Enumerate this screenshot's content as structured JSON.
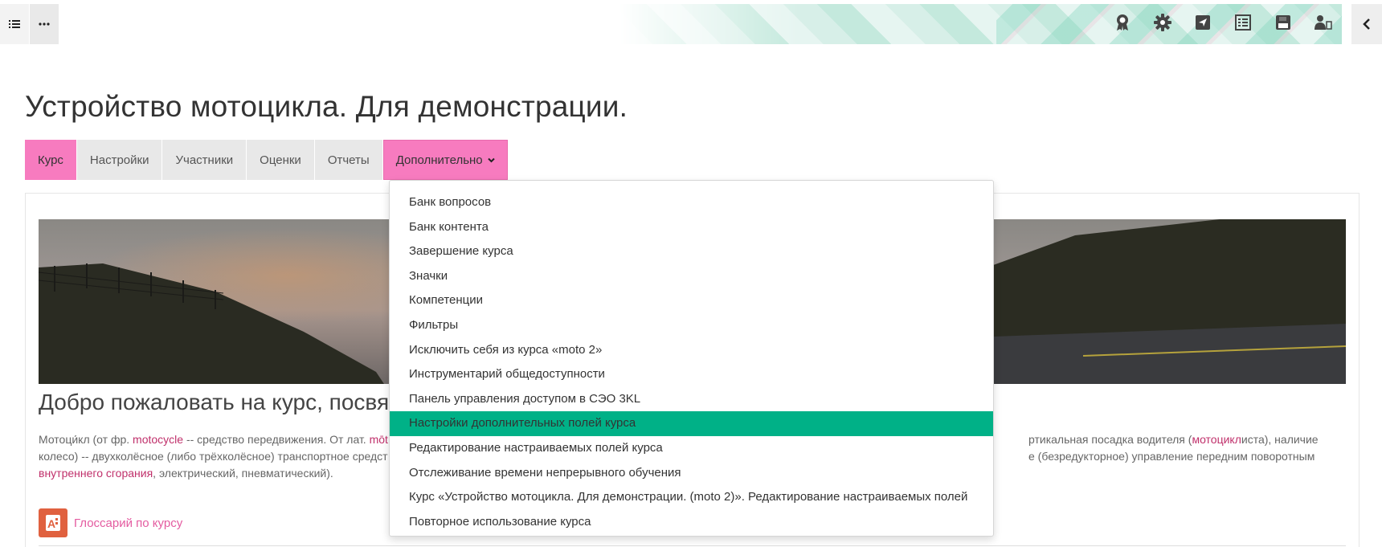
{
  "colors": {
    "accent_pink": "#f77bbf",
    "highlight_green": "#00b187",
    "link": "#c0306b"
  },
  "toolbar": {
    "left": [
      {
        "icon": "list-icon"
      },
      {
        "icon": "more-horizontal-icon",
        "label": "···"
      }
    ],
    "right_icons": [
      "award-icon",
      "gear-icon",
      "send-icon",
      "checklist-icon",
      "save-icon",
      "user-switch-icon"
    ],
    "collapse_icon": "chevron-left-icon"
  },
  "page": {
    "title": "Устройство мотоцикла. Для демонстрации."
  },
  "tabs": [
    {
      "label": "Курс",
      "active": true
    },
    {
      "label": "Настройки"
    },
    {
      "label": "Участники"
    },
    {
      "label": "Оценки"
    },
    {
      "label": "Отчеты"
    },
    {
      "label": "Дополнительно",
      "open": true
    }
  ],
  "dropdown": {
    "items": [
      "Банк вопросов",
      "Банк контента",
      "Завершение курса",
      "Значки",
      "Компетенции",
      "Фильтры",
      "Исключить себя из курса «moto 2»",
      "Инструментарий общедоступности",
      "Панель управления доступом в СЭО 3KL",
      "Настройки дополнительных полей курса",
      "Редактирование настраиваемых полей курса",
      "Отслеживание времени непрерывного обучения",
      "Курс «Устройство мотоцикла. Для демонстрации. (moto 2)». Редактирование настраиваемых полей",
      "Повторное использование курса"
    ],
    "highlighted": "Настройки дополнительных полей курса"
  },
  "content": {
    "welcome": "Добро пожаловать на курс, посвящ",
    "para": {
      "l1_a": "Мотоци́кл (от фр. ",
      "l1_link1": "motocycle",
      "l1_b": " -- средство передвижения. От лат. ",
      "l1_link2": "mōt",
      "l1_right_a": "ртикальная посадка водителя (",
      "l1_right_link": "мотоцикл",
      "l1_right_b": "иста), наличие",
      "l2_left": "колесо) -- двухколёсное (либо трёхколёсное) транспортное средст",
      "l2_right": "е (безредукторное) управление передним поворотным",
      "l3_link": "внутреннего сгорания",
      "l3_rest": ", электрический, пневматический)."
    },
    "glossary": {
      "label": "Глоссарий по курсу",
      "icon": "glossary-icon"
    }
  }
}
